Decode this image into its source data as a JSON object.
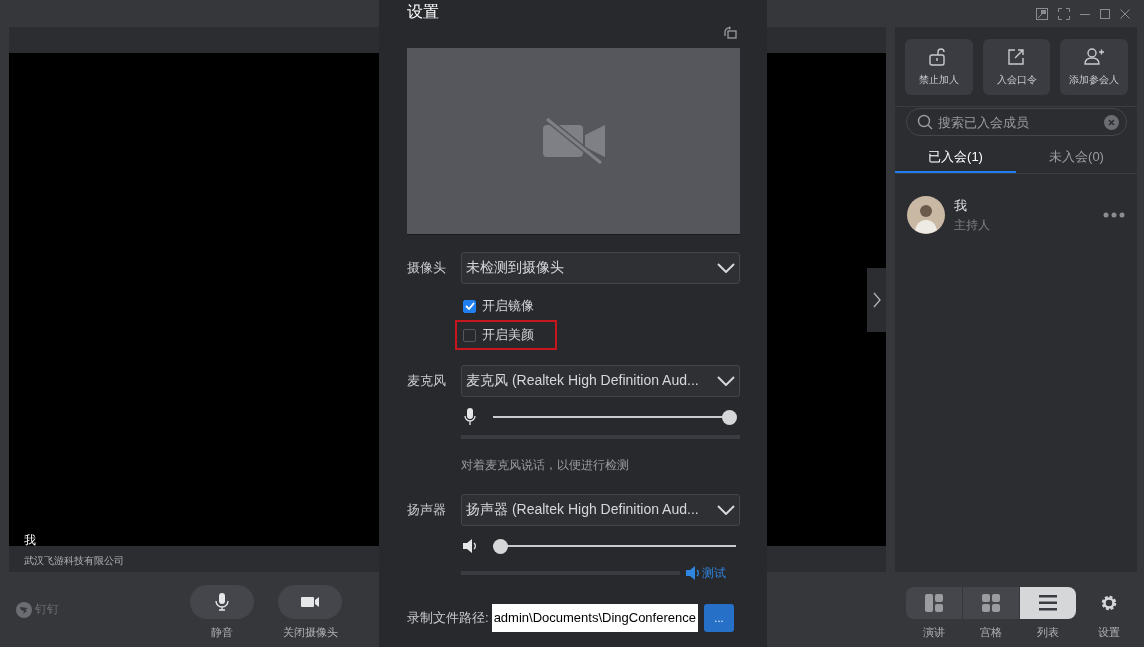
{
  "video": {
    "name": "我",
    "organization": "武汉飞游科技有限公司"
  },
  "brand": {
    "name": "钉钉"
  },
  "toolbar": [
    {
      "label": "静音",
      "kind": "mic"
    },
    {
      "label": "关闭摄像头",
      "kind": "camera"
    }
  ],
  "layout_modes": [
    {
      "label": "演讲",
      "kind": "speaker",
      "selected": false
    },
    {
      "label": "宫格",
      "kind": "grid",
      "selected": false
    },
    {
      "label": "列表",
      "kind": "list",
      "selected": true
    }
  ],
  "settings_button": {
    "label": "设置"
  },
  "panel": {
    "actions": [
      {
        "label": "禁止加人",
        "kind": "lock"
      },
      {
        "label": "入会口令",
        "kind": "share"
      },
      {
        "label": "添加参会人",
        "kind": "add-user"
      }
    ],
    "search": {
      "placeholder": "搜索已入会成员"
    },
    "tabs": [
      {
        "label": "已入会(1)",
        "selected": true
      },
      {
        "label": "未入会(0)",
        "selected": false
      }
    ],
    "members": [
      {
        "name": "我",
        "role": "主持人"
      }
    ]
  },
  "dialog": {
    "title": "设置",
    "camera": {
      "label": "摄像头",
      "value": "未检测到摄像头"
    },
    "options": [
      {
        "label": "开启镜像",
        "checked": true,
        "highlighted": false
      },
      {
        "label": "开启美颜",
        "checked": false,
        "highlighted": true
      }
    ],
    "microphone": {
      "label": "麦克风",
      "value": "麦克风 (Realtek High Definition Aud...",
      "volume": {
        "level": 1
      },
      "meter": {
        "level": 0
      },
      "hint": "对着麦克风说话，以便进行检测"
    },
    "speaker": {
      "label": "扬声器",
      "value": "扬声器 (Realtek High Definition Aud...",
      "volume": {
        "level": 0
      },
      "meter": {
        "level": 0
      },
      "test": "测试"
    },
    "recording": {
      "label": "录制文件路径:",
      "value": "admin\\Documents\\DingConference",
      "button": "..."
    }
  }
}
